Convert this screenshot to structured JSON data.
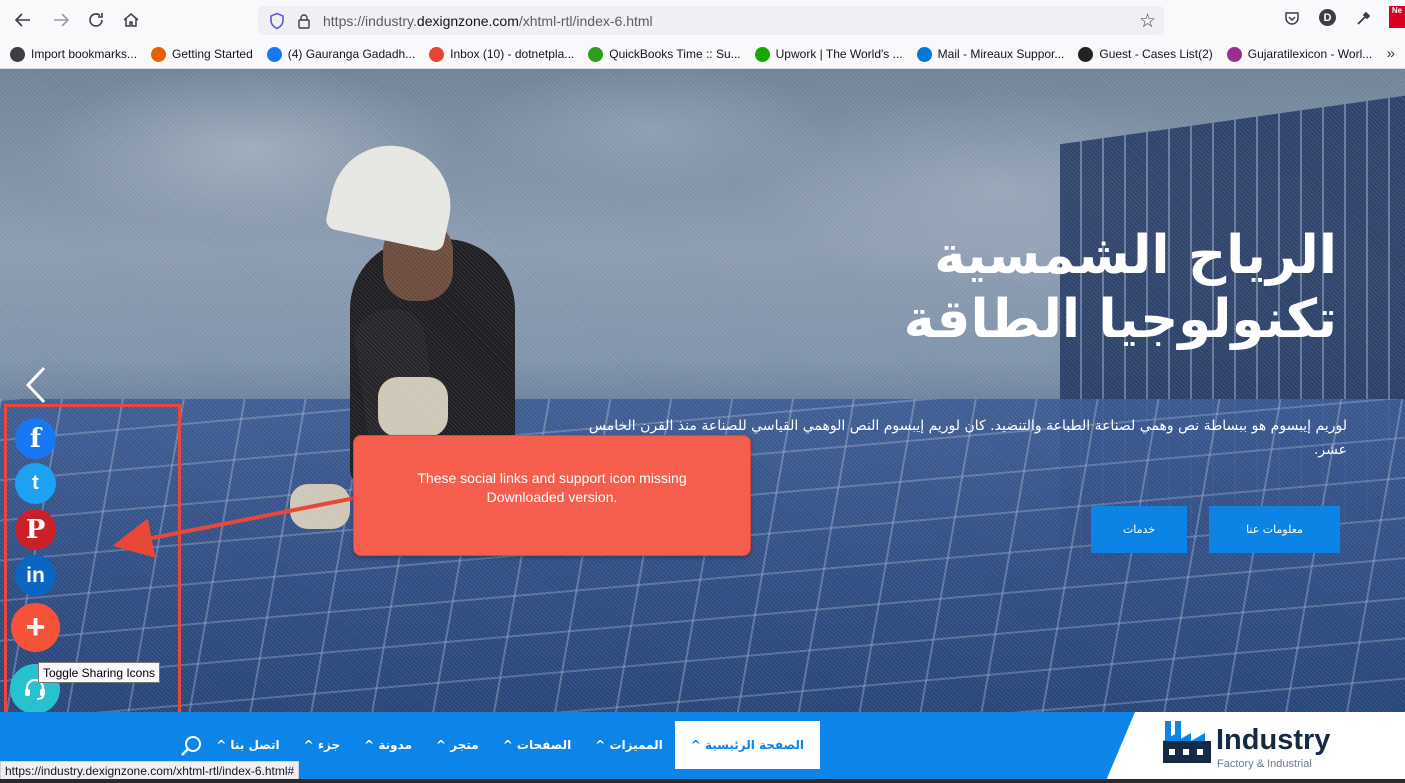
{
  "browser": {
    "url_prefix": "https://industry.",
    "url_domain": "dexignzone.com",
    "url_path": "/xhtml-rtl/index-6.html",
    "profile_letter": "D",
    "bookmarks": [
      {
        "label": "Import bookmarks...",
        "icon": "import-icon",
        "color": "#3d3d42"
      },
      {
        "label": "Getting Started",
        "icon": "firefox-icon",
        "color": "#e66000"
      },
      {
        "label": "(4) Gauranga Gadadh...",
        "icon": "facebook-icon",
        "color": "#1877f2"
      },
      {
        "label": "Inbox (10) - dotnetpla...",
        "icon": "gmail-icon",
        "color": "#ea4335"
      },
      {
        "label": "QuickBooks Time :: Su...",
        "icon": "quickbooks-icon",
        "color": "#2ca01c"
      },
      {
        "label": "Upwork | The World's ...",
        "icon": "upwork-icon",
        "color": "#14a800"
      },
      {
        "label": "Mail - Mireaux Suppor...",
        "icon": "outlook-icon",
        "color": "#0078d4"
      },
      {
        "label": "Guest - Cases List(2)",
        "icon": "m-icon",
        "color": "#222222"
      },
      {
        "label": "Gujaratilexicon - Worl...",
        "icon": "gl-icon",
        "color": "#9b2d8e"
      }
    ]
  },
  "hero": {
    "title_line1": "الرياح الشمسية",
    "title_line2": "تكنولوجيا الطاقة",
    "description": "لوريم إيبسوم هو ببساطة نص وهمي لصناعة الطباعة والتنضيد. كان لوريم إيبسوم النص الوهمي القياسي للصناعة منذ القرن الخامس عشر.",
    "btn_services": "خدمات",
    "btn_about": "معلومات عنا"
  },
  "social": {
    "tooltip": "Toggle Sharing Icons",
    "items": [
      {
        "name": "facebook",
        "glyph": "f",
        "color": "#1877f2"
      },
      {
        "name": "twitter",
        "glyph": "t",
        "color": "#1da1f2"
      },
      {
        "name": "pinterest",
        "glyph": "P",
        "color": "#cb2027"
      },
      {
        "name": "linkedin",
        "glyph": "in",
        "color": "#0a66c2"
      },
      {
        "name": "more",
        "glyph": "+",
        "color": "#f5523a"
      },
      {
        "name": "support",
        "glyph": "",
        "color": "#28c1cf"
      }
    ]
  },
  "annotation": {
    "line1": "These social links and support icon missing",
    "line2": "Downloaded version."
  },
  "nav": {
    "logo_name": "Industry",
    "logo_sub": "Factory & Industrial",
    "items": [
      {
        "label": "الصفحة الرئيسية ^",
        "active": true
      },
      {
        "label": "المميزات ^",
        "active": false
      },
      {
        "label": "الصفحات ^",
        "active": false
      },
      {
        "label": "متجر ^",
        "active": false
      },
      {
        "label": "مدونة ^",
        "active": false
      },
      {
        "label": "جزء ^",
        "active": false
      },
      {
        "label": "اتصل بنا ^",
        "active": false
      }
    ]
  },
  "status_url": "https://industry.dexignzone.com/xhtml-rtl/index-6.html#"
}
